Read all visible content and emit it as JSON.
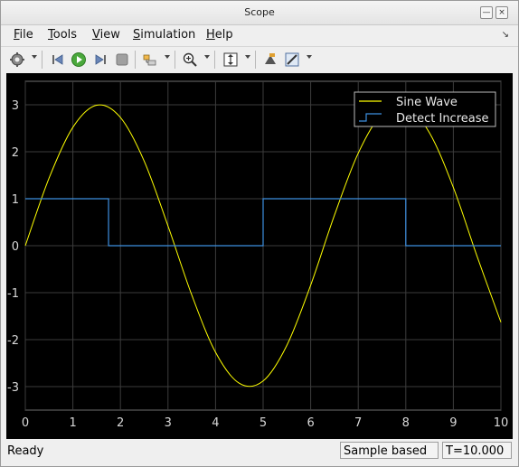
{
  "window": {
    "title": "Scope"
  },
  "menu": {
    "items": [
      {
        "label": "File",
        "underline": "F",
        "rest": "ile"
      },
      {
        "label": "Tools",
        "underline": "T",
        "rest": "ools"
      },
      {
        "label": "View",
        "underline": "V",
        "rest": "iew"
      },
      {
        "label": "Simulation",
        "underline": "S",
        "rest": "imulation"
      },
      {
        "label": "Help",
        "underline": "H",
        "rest": "elp"
      }
    ]
  },
  "toolbar": {
    "buttons": [
      "settings-gear-icon",
      "step-back-icon",
      "run-icon",
      "step-forward-icon",
      "stop-icon",
      "signal-select-icon",
      "zoom-in-icon",
      "fit-axes-icon",
      "highlight-icon",
      "style-edit-icon"
    ]
  },
  "chart_data": {
    "type": "line",
    "xlim": [
      0,
      10
    ],
    "ylim": [
      -3.5,
      3.5
    ],
    "x_ticks": [
      "0",
      "1",
      "2",
      "3",
      "4",
      "5",
      "6",
      "7",
      "8",
      "9",
      "10"
    ],
    "y_ticks": [
      "3",
      "2",
      "1",
      "0",
      "-1",
      "-2",
      "-3"
    ],
    "grid": true,
    "legend_position": "top-right",
    "series": [
      {
        "name": "Sine Wave",
        "color": "#ffff00",
        "style": "line",
        "x": [
          0,
          0.5,
          1,
          1.5,
          2,
          2.5,
          3,
          3.5,
          4,
          4.5,
          5,
          5.5,
          6,
          6.5,
          7,
          7.5,
          8,
          8.5,
          9,
          9.5,
          10
        ],
        "y": [
          0,
          1.44,
          2.52,
          2.99,
          2.73,
          1.8,
          0.42,
          -1.05,
          -2.27,
          -2.93,
          -2.88,
          -2.12,
          -0.84,
          0.65,
          1.97,
          2.81,
          2.97,
          2.4,
          1.24,
          -0.23,
          -1.63
        ]
      },
      {
        "name": "Detect Increase",
        "color": "#3d8fe0",
        "style": "step",
        "x": [
          0,
          1.75,
          1.75,
          5,
          5,
          8,
          8,
          10
        ],
        "y": [
          1,
          1,
          0,
          0,
          1,
          1,
          0,
          0
        ]
      }
    ]
  },
  "status": {
    "text": "Ready",
    "mode": "Sample based",
    "time": "T=10.000"
  }
}
